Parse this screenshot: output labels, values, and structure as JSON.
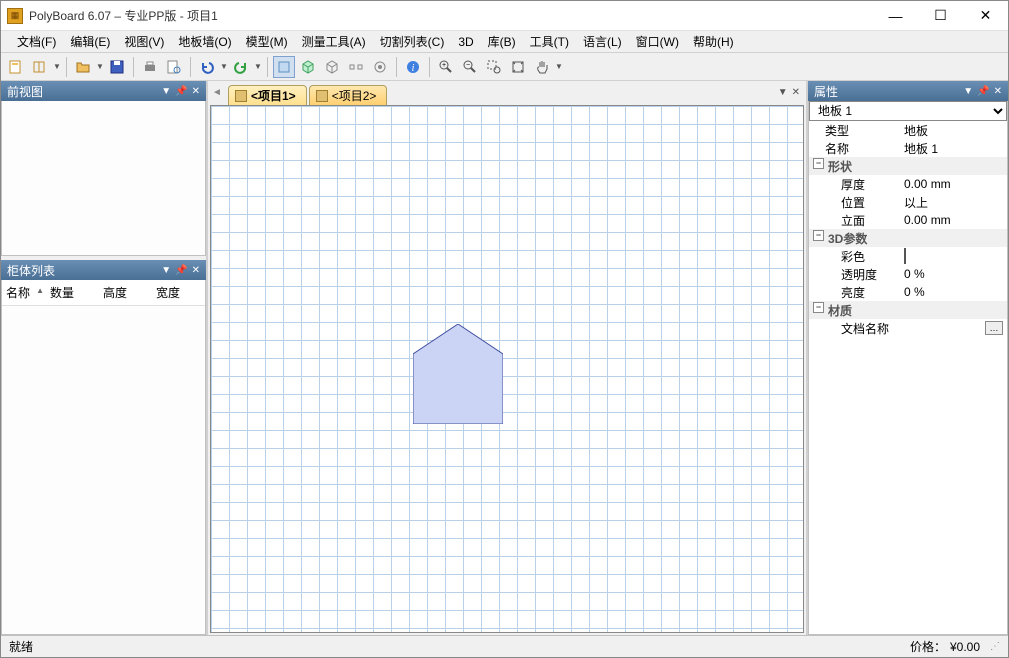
{
  "window": {
    "title": "PolyBoard 6.07 – 专业PP版 - 项目1"
  },
  "menu": {
    "file": "文档(F)",
    "edit": "编辑(E)",
    "view": "视图(V)",
    "floorwall": "地板墙(O)",
    "model": "模型(M)",
    "measure": "测量工具(A)",
    "cutlist": "切割列表(C)",
    "td": "3D",
    "library": "库(B)",
    "tools": "工具(T)",
    "language": "语言(L)",
    "wnd": "窗口(W)",
    "help": "帮助(H)"
  },
  "panels": {
    "frontview": "前视图",
    "cabinet": "柜体列表",
    "properties": "属性"
  },
  "cabinet_cols": {
    "name": "名称",
    "qty": "数量",
    "height": "高度",
    "width": "宽度"
  },
  "tabs": {
    "project1": "<项目1>",
    "project2": "<项目2>"
  },
  "properties": {
    "selected": "地板 1",
    "type_k": "类型",
    "type_v": "地板",
    "name_k": "名称",
    "name_v": "地板 1",
    "shape_group": "形状",
    "thickness_k": "厚度",
    "thickness_v": "0.00 mm",
    "position_k": "位置",
    "position_v": "以上",
    "elevation_k": "立面",
    "elevation_v": "0.00 mm",
    "td_group": "3D参数",
    "color_k": "彩色",
    "trans_k": "透明度",
    "trans_v": "0 %",
    "bright_k": "亮度",
    "bright_v": "0 %",
    "material_group": "材质",
    "docname_k": "文档名称"
  },
  "status": {
    "ready": "就绪",
    "price_label": "价格：",
    "price_value": "¥0.00"
  }
}
